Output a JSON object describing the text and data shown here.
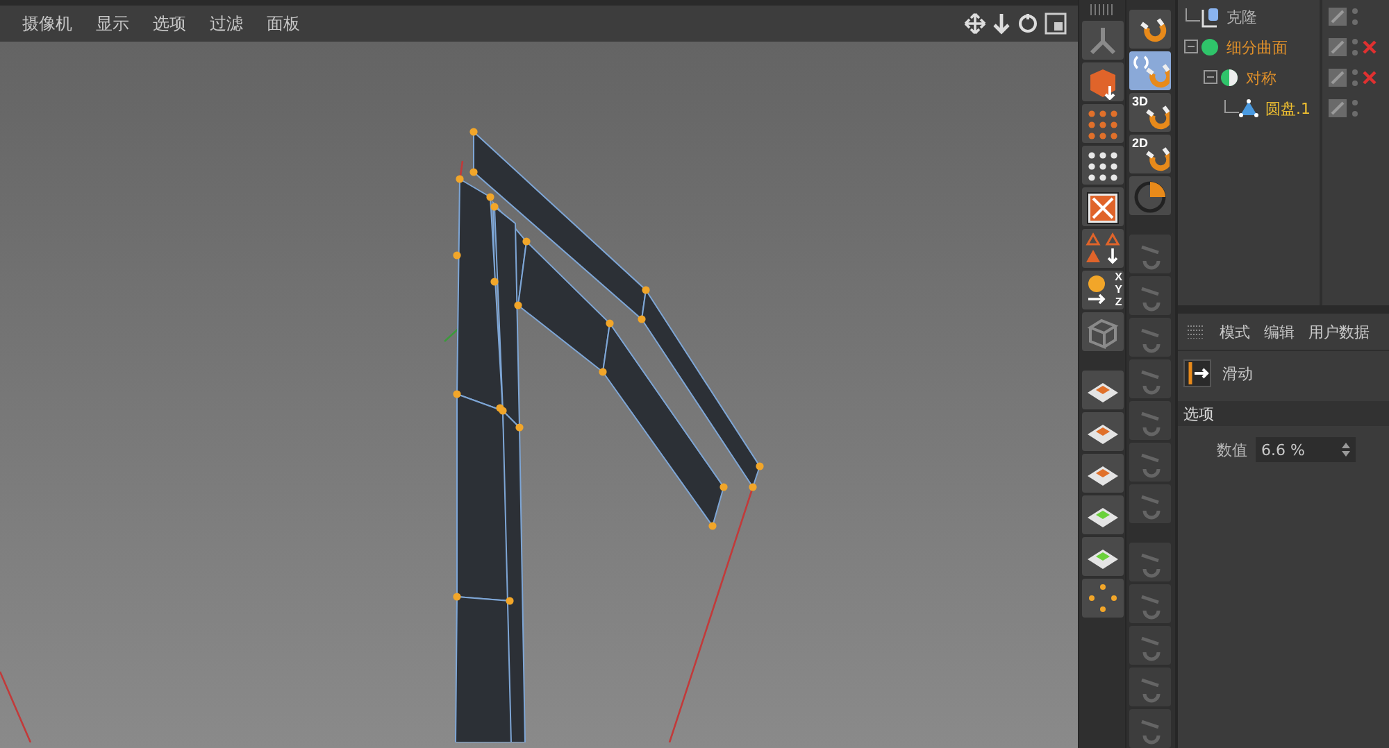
{
  "viewport": {
    "menu": [
      "摄像机",
      "显示",
      "选项",
      "过滤",
      "面板"
    ]
  },
  "toolbar_left": [
    {
      "kind": "joint"
    },
    {
      "kind": "cube-down"
    },
    {
      "kind": "dots",
      "color": "#e0702a"
    },
    {
      "kind": "dots",
      "color": "#e8e8e8"
    },
    {
      "kind": "cross-box"
    },
    {
      "kind": "triangles"
    },
    {
      "kind": "xyz",
      "labels": [
        "X",
        "Y",
        "Z"
      ]
    },
    {
      "kind": "cage"
    },
    {
      "kind": "gap"
    },
    {
      "kind": "plane",
      "color": "#e0702a"
    },
    {
      "kind": "plane",
      "color": "#e0702a"
    },
    {
      "kind": "plane",
      "color": "#e0702a"
    },
    {
      "kind": "plane",
      "color": "#6ad13a"
    },
    {
      "kind": "plane",
      "color": "#6ad13a"
    },
    {
      "kind": "points"
    }
  ],
  "toolbar_right": [
    {
      "kind": "magnet",
      "selected": false,
      "disabled": false
    },
    {
      "kind": "magnet-parens",
      "selected": true,
      "disabled": false
    },
    {
      "kind": "magnet-label",
      "text": "3D",
      "selected": false,
      "disabled": false
    },
    {
      "kind": "magnet-label",
      "text": "2D",
      "selected": false,
      "disabled": false
    },
    {
      "kind": "circle",
      "selected": false,
      "disabled": false
    },
    {
      "kind": "gap"
    },
    {
      "kind": "ghost",
      "selected": false,
      "disabled": true
    },
    {
      "kind": "ghost",
      "selected": false,
      "disabled": true
    },
    {
      "kind": "ghost",
      "selected": false,
      "disabled": true
    },
    {
      "kind": "ghost",
      "selected": false,
      "disabled": true
    },
    {
      "kind": "ghost",
      "selected": false,
      "disabled": true
    },
    {
      "kind": "ghost",
      "selected": false,
      "disabled": true
    },
    {
      "kind": "ghost",
      "selected": false,
      "disabled": true
    },
    {
      "kind": "gap"
    },
    {
      "kind": "ghost",
      "selected": false,
      "disabled": true
    },
    {
      "kind": "ghost",
      "selected": false,
      "disabled": true
    },
    {
      "kind": "ghost",
      "selected": false,
      "disabled": true
    },
    {
      "kind": "ghost",
      "selected": false,
      "disabled": true
    },
    {
      "kind": "ghost",
      "selected": false,
      "disabled": true
    }
  ],
  "objects": [
    {
      "name": "克隆",
      "color": "#b4b4b4",
      "kind": "cloner",
      "enabled": true
    },
    {
      "name": "细分曲面",
      "color": "#e0902a",
      "kind": "subdivision",
      "enabled": false,
      "children": [
        {
          "name": "对称",
          "color": "#e0902a",
          "kind": "symmetry",
          "enabled": false,
          "children": [
            {
              "name": "圆盘.1",
              "color": "#f0c030",
              "kind": "disc",
              "enabled": true
            }
          ]
        }
      ]
    }
  ],
  "attributes": {
    "tabs": [
      "模式",
      "编辑",
      "用户数据"
    ],
    "tool": "滑动",
    "section": "选项",
    "fields": [
      {
        "label": "数值",
        "value": "6.6 %"
      }
    ]
  }
}
